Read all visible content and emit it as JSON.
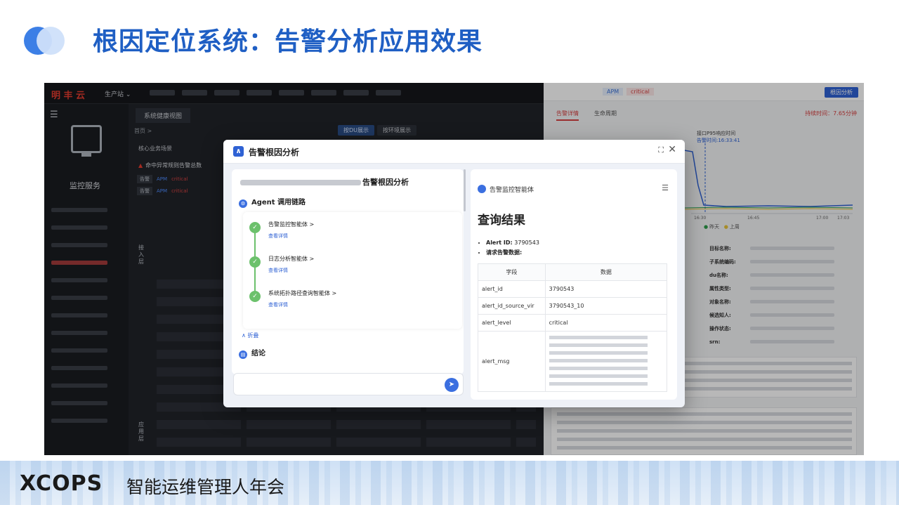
{
  "slide": {
    "title": "根因定位系统：告警分析应用效果",
    "footer_brand": "XCOPS",
    "footer_text": "智能运维管理人年会"
  },
  "bg_app": {
    "brand": "明 丰 云",
    "env": "生产站 ⌄",
    "tab": "系统健康视图",
    "breadcrumb_home": "首页 >",
    "view_du": "按DU展示",
    "view_env": "按环境展示",
    "scene_label": "核心业务场景",
    "service_label": "监控服务",
    "alarm_title": "命中异常规则告警总数",
    "rows": [
      {
        "tag": "告警",
        "apm": "APM",
        "level": "critical"
      },
      {
        "tag": "告警",
        "apm": "APM",
        "level": "critical"
      }
    ],
    "layer_access": "接入层",
    "layer_app": "应用层"
  },
  "detail_panel": {
    "apm": "APM",
    "critical": "critical",
    "rca_button": "根因分析",
    "tabs": [
      "告警详情",
      "生命周期"
    ],
    "duration": "持续时间：7.65分钟",
    "chart_title": "接口P95响应时间",
    "chart_time": "告警时间:16:33:41",
    "x_ticks": [
      "16:30\n12-17",
      "16:45\n12-17",
      "17:00\n12-17",
      "17:03\n12-17"
    ],
    "legend": [
      "昨天",
      "上周"
    ],
    "fields": [
      "目标名称:",
      "子系统编码:",
      "du名称:",
      "属性类型:",
      "对象名称:",
      "候选知人:",
      "操作状态:",
      "srn:"
    ]
  },
  "modal": {
    "title": "告警根因分析",
    "analysis_suffix": "告警根因分析",
    "agent_chain_title": "Agent 调用链路",
    "steps": [
      {
        "name": "告警监控智能体 >",
        "link": "查看详情"
      },
      {
        "name": "日志分析智能体 >",
        "link": "查看详情"
      },
      {
        "name": "系统拓扑路径查询智能体 >",
        "link": "查看详情"
      }
    ],
    "collapse": "∧ 折叠",
    "conclusion": "结论",
    "right_agent": "告警监控智能体",
    "result_title": "查询结果",
    "alert_id_label": "Alert ID:",
    "alert_id_value": "3790543",
    "request_label": "请求告警数据:",
    "table_headers": [
      "字段",
      "数据"
    ],
    "table_rows": [
      {
        "field": "alert_id",
        "value": "3790543"
      },
      {
        "field": "alert_id_source_vir",
        "value": "3790543_10"
      },
      {
        "field": "alert_level",
        "value": "critical"
      },
      {
        "field": "alert_msg",
        "value": ""
      }
    ]
  },
  "icons": {
    "expand": "expand-icon",
    "close": "close-icon",
    "send": "send-icon",
    "menu": "menu-icon",
    "check": "check-icon",
    "monitor": "monitor-icon"
  },
  "colors": {
    "title_blue": "#1f5fc4",
    "accent_blue": "#2f62d4",
    "success_green": "#6cc16c",
    "critical_red": "#d64141"
  }
}
